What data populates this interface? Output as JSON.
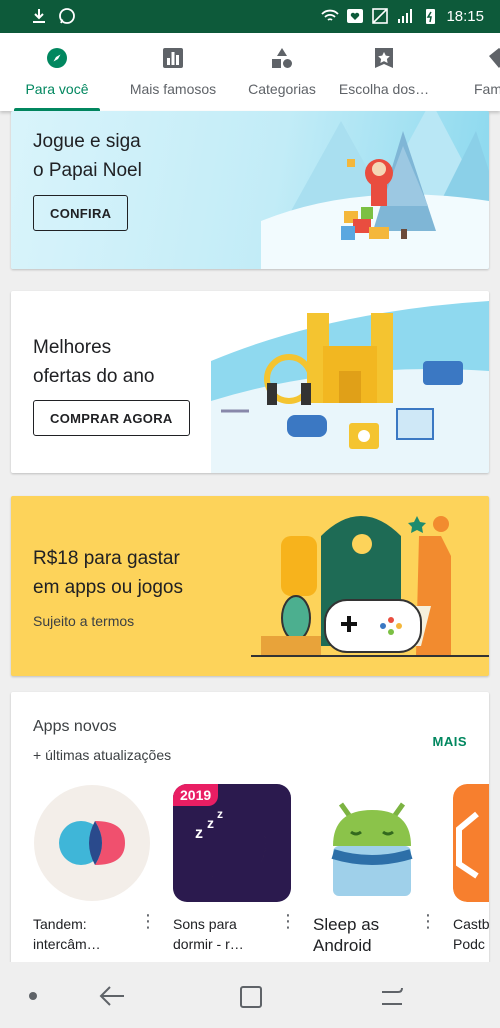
{
  "status_bar": {
    "time": "18:15"
  },
  "tabs": [
    {
      "label": "Para você",
      "icon": "compass-icon",
      "active": true
    },
    {
      "label": "Mais famosos",
      "icon": "chart-icon",
      "active": false
    },
    {
      "label": "Categorias",
      "icon": "shapes-icon",
      "active": false
    },
    {
      "label": "Escolha dos…",
      "icon": "star-badge-icon",
      "active": false
    },
    {
      "label": "Fam",
      "icon": "family-icon",
      "active": false
    }
  ],
  "banners": [
    {
      "title": "Jogue e siga\no Papai Noel",
      "button": "CONFIRA",
      "image": "santa-illustration"
    },
    {
      "title": "Melhores\nofertas do ano",
      "button": "COMPRAR AGORA",
      "image": "castle-illustration"
    },
    {
      "title": "R$18 para gastar\nem apps ou jogos",
      "subtitle": "Sujeito a termos",
      "image": "gamepad-illustration"
    }
  ],
  "section": {
    "title": "Apps novos",
    "subtitle": "+ últimas atualizações",
    "more": "MAIS",
    "apps": [
      {
        "name": "Tandem:\nintercâm…",
        "icon": "tandem-app-icon"
      },
      {
        "name": "Sons para\ndormir - r…",
        "icon": "moon-app-icon",
        "badge": "2019"
      },
      {
        "name": "Sleep as\nAndroid",
        "icon": "sleep-android-app-icon"
      },
      {
        "name": "Castb\nPodc",
        "icon": "castbox-app-icon"
      }
    ]
  },
  "colors": {
    "accent": "#01875f",
    "status_bar": "#0d5a3a",
    "yellow_banner": "#fdd35a"
  }
}
